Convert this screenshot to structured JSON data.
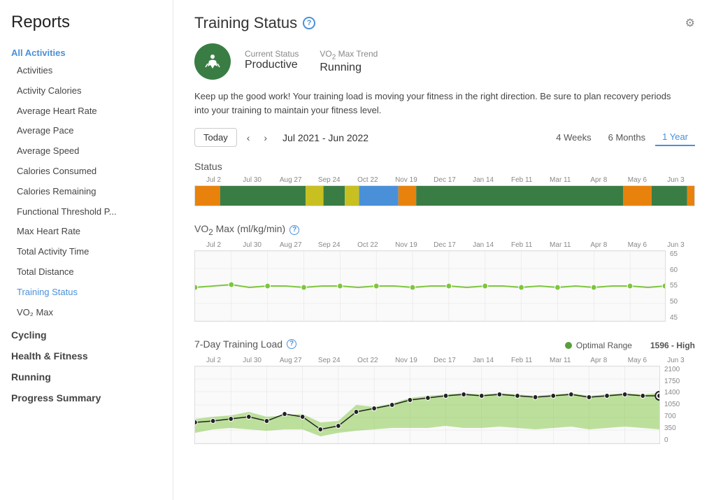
{
  "sidebar": {
    "title": "Reports",
    "sections": [
      {
        "label": "All Activities",
        "items": [
          "Activities",
          "Activity Calories",
          "Average Heart Rate",
          "Average Pace",
          "Average Speed",
          "Calories Consumed",
          "Calories Remaining",
          "Functional Threshold P...",
          "Max Heart Rate",
          "Total Activity Time",
          "Total Distance",
          "Training Status",
          "VO₂ Max"
        ],
        "activeItem": "Training Status"
      }
    ],
    "groups": [
      "Cycling",
      "Health & Fitness",
      "Running",
      "Progress Summary"
    ]
  },
  "main": {
    "title": "Training Status",
    "status": {
      "statusLabel": "Current Status",
      "statusValue": "Productive",
      "trendLabel": "VO₂ Max Trend",
      "trendValue": "Running"
    },
    "description": "Keep up the good work! Your training load is moving your fitness in the right direction. Be sure to plan recovery periods into your training to maintain your fitness level.",
    "dateRange": "Jul 2021 - Jun 2022",
    "periodButtons": [
      "4 Weeks",
      "6 Months",
      "1 Year"
    ],
    "activePeriod": "1 Year",
    "todayLabel": "Today",
    "charts": {
      "status": {
        "title": "Status",
        "xLabels": [
          "Jul 2",
          "Jul 30",
          "Aug 27",
          "Sep 24",
          "Oct 22",
          "Nov 19",
          "Dec 17",
          "Jan 14",
          "Feb 11",
          "Mar 11",
          "Apr 8",
          "May 6",
          "Jun 3"
        ]
      },
      "vo2": {
        "title": "VO₂ Max (ml/kg/min)",
        "xLabels": [
          "Jul 2",
          "Jul 30",
          "Aug 27",
          "Sep 24",
          "Oct 22",
          "Nov 19",
          "Dec 17",
          "Jan 14",
          "Feb 11",
          "Mar 11",
          "Apr 8",
          "May 6",
          "Jun 3"
        ],
        "yLabels": [
          "65",
          "60",
          "55",
          "50",
          "45"
        ]
      },
      "trainingLoad": {
        "title": "7-Day Training Load",
        "legendLabel": "Optimal Range",
        "highLabel": "1596 - High",
        "xLabels": [
          "Jul 2",
          "Jul 30",
          "Aug 27",
          "Sep 24",
          "Oct 22",
          "Nov 19",
          "Dec 17",
          "Jan 14",
          "Feb 11",
          "Mar 11",
          "Apr 8",
          "May 6",
          "Jun 3"
        ],
        "yLabels": [
          "2100",
          "1750",
          "1400",
          "1050",
          "700",
          "350",
          "0"
        ]
      }
    }
  },
  "icons": {
    "info": "?",
    "gear": "⚙",
    "running": "🏃",
    "prev": "‹",
    "next": "›"
  }
}
